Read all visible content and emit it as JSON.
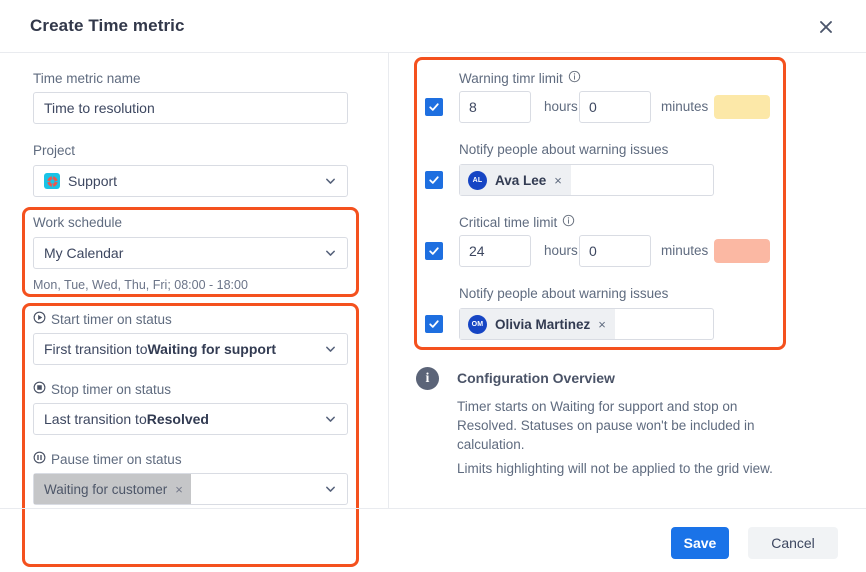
{
  "dialog": {
    "title": "Create Time metric",
    "close_icon": "close-icon"
  },
  "left": {
    "name": {
      "label": "Time metric name",
      "value": "Time to resolution",
      "placeholder": "Time metric name"
    },
    "project": {
      "label": "Project",
      "value": "Support",
      "icon": "lifebuoy-icon",
      "icon_bg": "#19c3e6"
    },
    "schedule": {
      "label": "Work schedule",
      "value": "My Calendar",
      "note": "Mon, Tue, Wed, Thu, Fri; 08:00 - 18:00"
    },
    "start_timer": {
      "label": "Start timer on status",
      "icon": "play-circle-icon",
      "prefix": "First transition to ",
      "status": "Waiting for support"
    },
    "stop_timer": {
      "label": "Stop timer on status",
      "icon": "stop-circle-icon",
      "prefix": "Last transition to ",
      "status": "Resolved"
    },
    "pause_timer": {
      "label": "Pause timer on status",
      "icon": "pause-circle-icon",
      "chip": "Waiting for customer",
      "chip_remove": "×"
    }
  },
  "right": {
    "warning": {
      "label": "Warning timr limit",
      "info_icon": "info-outline-icon",
      "checked": true,
      "hours": "8",
      "hours_unit": "hours",
      "minutes": "0",
      "minutes_unit": "minutes",
      "swatch_color": "#fce8a8",
      "notify_label": "Notify people about warning issues",
      "notify_checked": true,
      "person_initials": "AL",
      "person_name": "Ava Lee",
      "person_remove": "×"
    },
    "critical": {
      "label": "Critical time limit",
      "info_icon": "info-outline-icon",
      "checked": true,
      "hours": "24",
      "hours_unit": "hours",
      "minutes": "0",
      "minutes_unit": "minutes",
      "swatch_color": "#fbb8a3",
      "notify_label": "Notify people about warning issues",
      "notify_checked": true,
      "person_initials": "OM",
      "person_name": "Olivia Martinez",
      "person_remove": "×"
    },
    "overview": {
      "icon": "info-circle-icon",
      "title": "Configuration Overview",
      "paragraph1": "Timer starts on Waiting for support and stop on Resolved. Statuses on pause won't be included in calculation.",
      "paragraph2": "Limits highlighting will not be applied to the grid view."
    }
  },
  "footer": {
    "save_label": "Save",
    "cancel_label": "Cancel"
  },
  "highlight_color": "#f4511e"
}
